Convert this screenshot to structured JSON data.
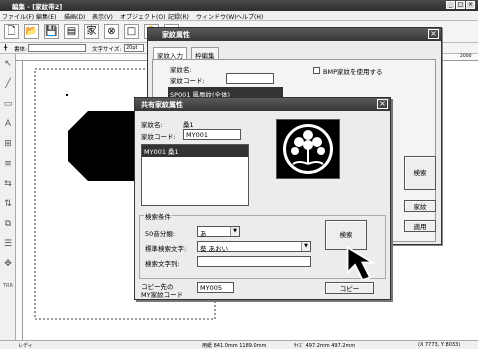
{
  "app": {
    "title": "編集 - [家紋帯2]",
    "menu": [
      "ファイル(F)",
      "編集(E)",
      "描画(D)",
      "表示(V)",
      "オブジェクト(O)",
      "記録(R)",
      "ウィンドウ(W)",
      "ヘルプ(H)"
    ],
    "toolbar2": {
      "font_label": "書体:",
      "size_label": "文字サイズ:",
      "size_value": "20pt"
    },
    "ruler_right_value": "2000",
    "left_tool_label": "TRR",
    "status": {
      "ready": "レディ",
      "pos": "用紙 841.0mm 1189.0mm",
      "size": "ｻｲｽﾞ 497.2mm 497.2mm",
      "coord": "(X 7773, Y 8033)"
    }
  },
  "dialog1": {
    "title": "家紋属性",
    "close": "×",
    "tabs": [
      "家紋入力",
      "枠編集"
    ],
    "name_label": "家紋名:",
    "code_label": "家紋コード:",
    "bmp_label": "BMP家紋を使用する",
    "list_item": "SP001 鳳凰紋(全体)",
    "search_label": "検索",
    "kamon_label": "家紋",
    "apply_label": "適用"
  },
  "dialog2": {
    "title": "共有家紋属性",
    "close": "×",
    "name_label": "家紋名:",
    "name_value": "桑1",
    "code_label": "家紋コード:",
    "code_value": "MY001",
    "list_items": [
      "MY001 桑1"
    ],
    "group_label": "検索条件",
    "sound_label": "50音分類:",
    "sound_value": "あ",
    "char_label": "標準検索文字:",
    "char_value": "葵 あおい",
    "str_label": "検索文字列:",
    "str_value": "",
    "copy_label_1": "コピー先の",
    "copy_label_2": "MY家紋コード",
    "copy_value": "MY005",
    "search_button": "検索",
    "copy_button": "コピー"
  }
}
